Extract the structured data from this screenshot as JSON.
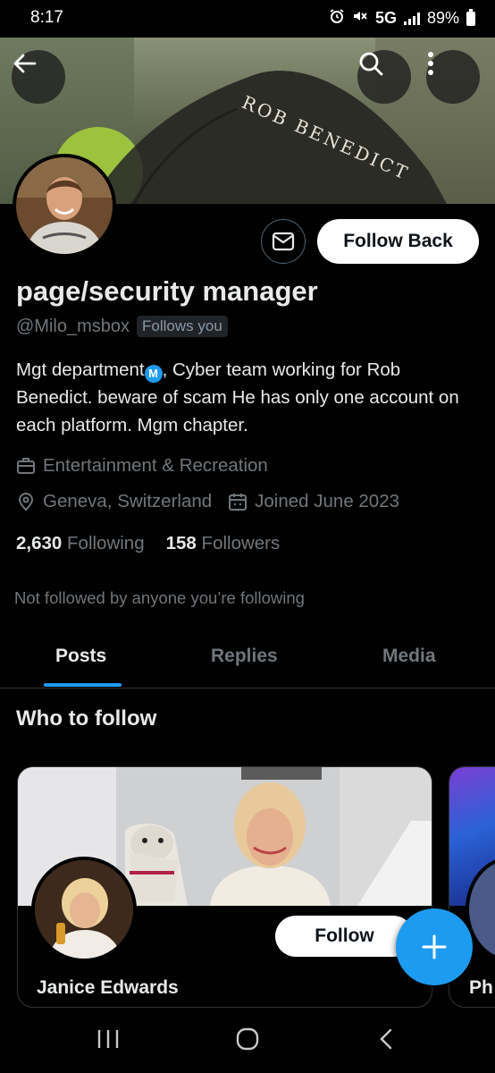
{
  "status_bar": {
    "time": "8:17",
    "network": "5G",
    "battery": "89%"
  },
  "banner": {
    "text": "ROB BENEDICT"
  },
  "profile": {
    "follow_back_label": "Follow Back",
    "display_name": "page/security manager",
    "handle": "@Milo_msbox",
    "follows_you_badge": "Follows you",
    "bio_part1": "Mgt department",
    "bio_verified_glyph": "M",
    "bio_part2": ",  Cyber team working for Rob Benedict.  beware of scam He has only one account on each platform.  Mgm chapter.",
    "category": "Entertainment & Recreation",
    "location": "Geneva, Switzerland",
    "joined": "Joined June 2023",
    "following_count": "2,630",
    "following_label": "Following",
    "followers_count": "158",
    "followers_label": "Followers",
    "not_followed_note": "Not followed by anyone you’re following"
  },
  "tabs": [
    {
      "label": "Posts",
      "active": true
    },
    {
      "label": "Replies",
      "active": false
    },
    {
      "label": "Media",
      "active": false
    }
  ],
  "who_to_follow": {
    "title": "Who to follow",
    "cards": [
      {
        "name": "Janice Edwards",
        "follow_label": "Follow"
      },
      {
        "name": "Ph"
      }
    ]
  },
  "colors": {
    "accent": "#1d9bf0",
    "background": "#000000",
    "primary_text": "#e7e9ea",
    "secondary_text": "#71767b"
  },
  "icons": {
    "back": "arrow-left-icon",
    "search": "search-icon",
    "more": "more-vertical-icon",
    "message": "envelope-icon",
    "category": "briefcase-icon",
    "location": "location-pin-icon",
    "joined": "calendar-icon",
    "compose": "plus-icon",
    "nav_recents": "recents-icon",
    "nav_home": "home-icon",
    "nav_back": "nav-back-icon"
  }
}
